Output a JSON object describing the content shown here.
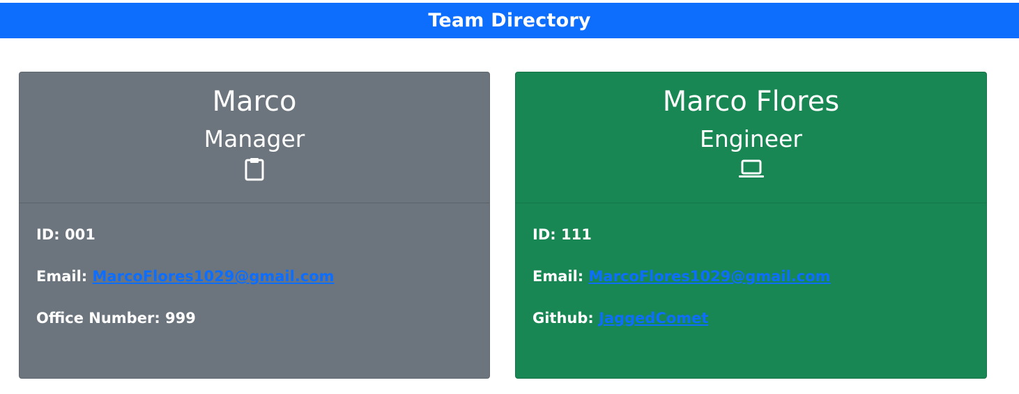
{
  "header": {
    "title": "Team Directory"
  },
  "cards": [
    {
      "name": "Marco",
      "role": "Manager",
      "icon": "clipboard-icon",
      "id_label": "ID:",
      "id_value": "001",
      "email_label": "Email:",
      "email_value": "MarcoFlores1029@gmail.com",
      "extra_label": "Office Number:",
      "extra_value": "999",
      "color": "#6c757d"
    },
    {
      "name": "Marco Flores",
      "role": "Engineer",
      "icon": "laptop-icon",
      "id_label": "ID:",
      "id_value": "111",
      "email_label": "Email:",
      "email_value": "MarcoFlores1029@gmail.com",
      "extra_label": "Github:",
      "extra_value": "JaggedComet",
      "color": "#198754"
    }
  ],
  "colors": {
    "header_bg": "#0d6efd",
    "link": "#0d6efd"
  }
}
